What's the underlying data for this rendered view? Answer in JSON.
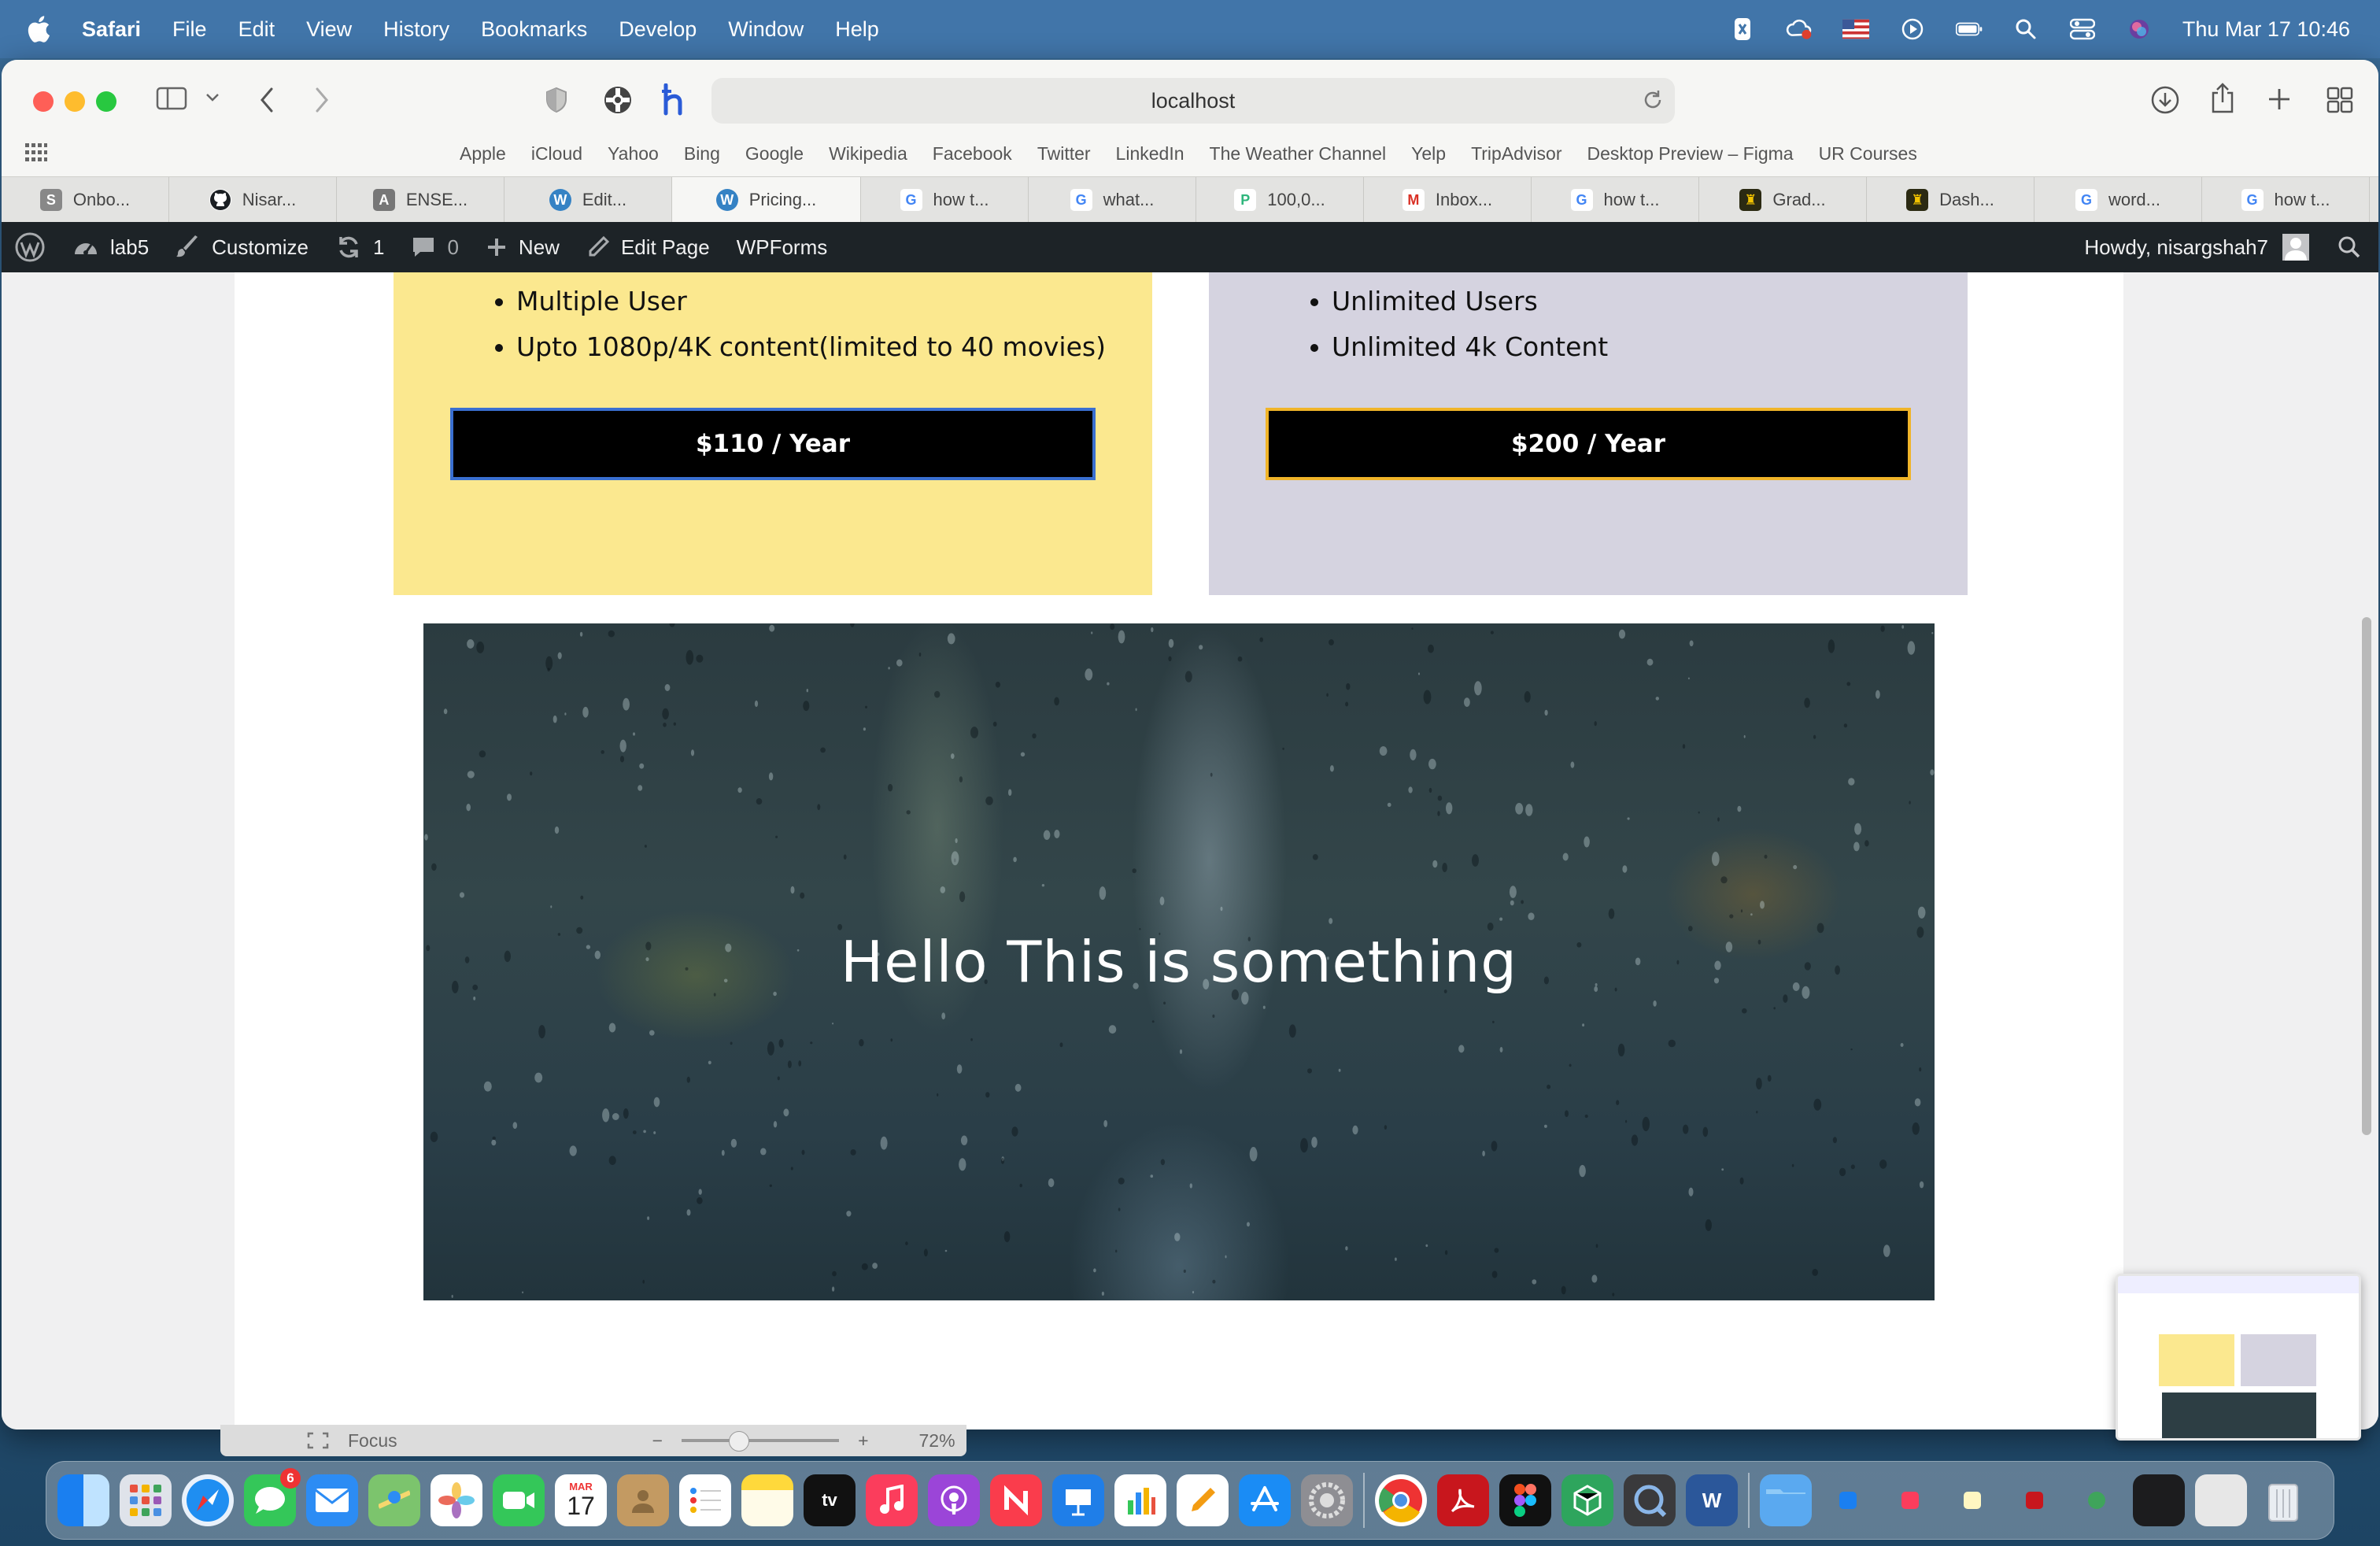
{
  "menubar": {
    "app_name": "Safari",
    "menus": [
      "File",
      "Edit",
      "View",
      "History",
      "Bookmarks",
      "Develop",
      "Window",
      "Help"
    ],
    "clock": "Thu Mar 17  10:46"
  },
  "browser": {
    "url": "localhost",
    "favorites": [
      "Apple",
      "iCloud",
      "Yahoo",
      "Bing",
      "Google",
      "Wikipedia",
      "Facebook",
      "Twitter",
      "LinkedIn",
      "The Weather Channel",
      "Yelp",
      "TripAdvisor",
      "Desktop Preview – Figma",
      "UR Courses"
    ],
    "tabs": [
      {
        "label": "Onbo...",
        "icon": "S"
      },
      {
        "label": "Nisar...",
        "icon": "github"
      },
      {
        "label": "ENSE...",
        "icon": "A"
      },
      {
        "label": "Edit...",
        "icon": "wordpress"
      },
      {
        "label": "Pricing...",
        "icon": "wordpress",
        "active": true
      },
      {
        "label": "how t...",
        "icon": "google"
      },
      {
        "label": "what...",
        "icon": "google"
      },
      {
        "label": "100,0...",
        "icon": "P"
      },
      {
        "label": "Inbox...",
        "icon": "gmail"
      },
      {
        "label": "how t...",
        "icon": "google"
      },
      {
        "label": "Grad...",
        "icon": "crest"
      },
      {
        "label": "Dash...",
        "icon": "crest"
      },
      {
        "label": "word...",
        "icon": "google"
      },
      {
        "label": "how t...",
        "icon": "google"
      }
    ]
  },
  "wp_admin_bar": {
    "site_name": "lab5",
    "customize": "Customize",
    "updates_count": "1",
    "comments_count": "0",
    "new": "New",
    "edit_page": "Edit Page",
    "wpforms": "WPForms",
    "howdy": "Howdy, nisargshah7"
  },
  "pricing": {
    "left_card": {
      "features": [
        "Multiple User",
        "Upto 1080p/4K content(limited to 40 movies)"
      ],
      "price_button": "$110 / Year",
      "background": "#fbe88f"
    },
    "right_card": {
      "features": [
        "Unlimited Users",
        "Unlimited 4k Content"
      ],
      "price_button": "$200 / Year",
      "background": "#d5d3e0"
    }
  },
  "hero": {
    "heading": "Hello This is something"
  },
  "focus_bar": {
    "label": "Focus",
    "zoom": "72%"
  },
  "dock": {
    "messages_badge": "6",
    "calendar_month": "MAR",
    "calendar_day": "17"
  }
}
